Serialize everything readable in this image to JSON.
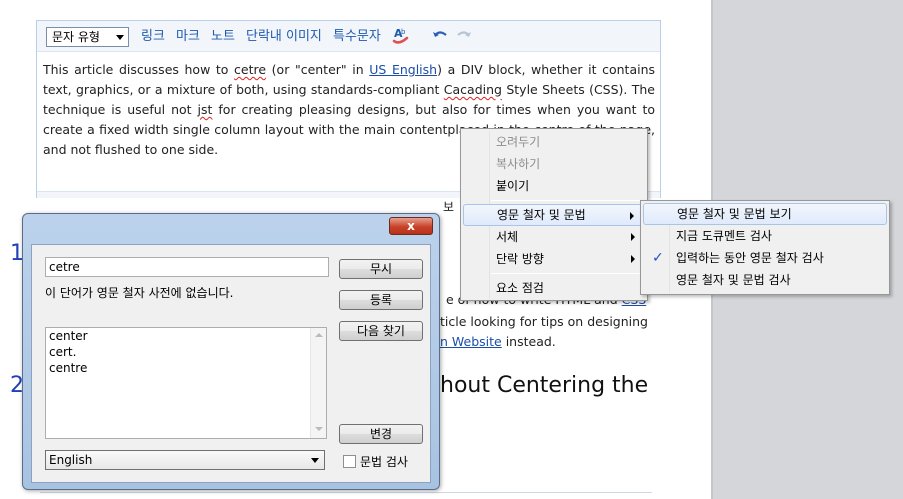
{
  "toolbar": {
    "format_select": "문자 유형",
    "links": [
      "링크",
      "마크",
      "노트",
      "단락내 이미지",
      "특수문자"
    ]
  },
  "editor": {
    "text_parts": [
      "This article discusses how to ",
      "cetre",
      " (or \"center\" in ",
      "US English",
      ") a DIV block, whether it contains text, graphics, or a mixture of both, using standards-compliant ",
      "Cacading",
      " Style Sheets (CSS). The technique is useful not ",
      "jst",
      " for creating pleasing designs, but also for times when you want to create a fixed width single column layout with the main contentpla",
      "ced in the centre of the page,",
      " and not flushed to one side."
    ]
  },
  "background": {
    "preview_fragment": "보",
    "heading_num_1": "1",
    "heading_num_2": "2",
    "line1_a": "e of how to write HTML and ",
    "line1_link": "CSS",
    "line1_b": "",
    "line2": "ticle looking for tips on designing",
    "line3_link": "n Website",
    "line3_b": " instead.",
    "heading": "hout Centering the"
  },
  "context_menu": {
    "items": [
      "오려두기",
      "복사하기",
      "붙이기",
      "영문 철자 및 문법",
      "서체",
      "단락 방향",
      "요소 점검"
    ]
  },
  "submenu": {
    "items": [
      "영문 철자 및 문법 보기",
      "지금 도큐멘트 검사",
      "입력하는 동안 영문 철자 검사",
      "영문 철자 및 문법 검사"
    ]
  },
  "dialog": {
    "close_label": "x",
    "word": "cetre",
    "message": "이 단어가 영문 철자 사전에 없습니다.",
    "buttons": [
      "무시",
      "등록",
      "다음 찾기",
      "변경"
    ],
    "suggestions": [
      "center",
      "cert.",
      "centre"
    ],
    "language": "English",
    "grammar_label": "문법 검사"
  },
  "colors": {
    "link": "#1f5ab0",
    "heading_number": "#2040b8",
    "spell_error": "#e02020"
  }
}
